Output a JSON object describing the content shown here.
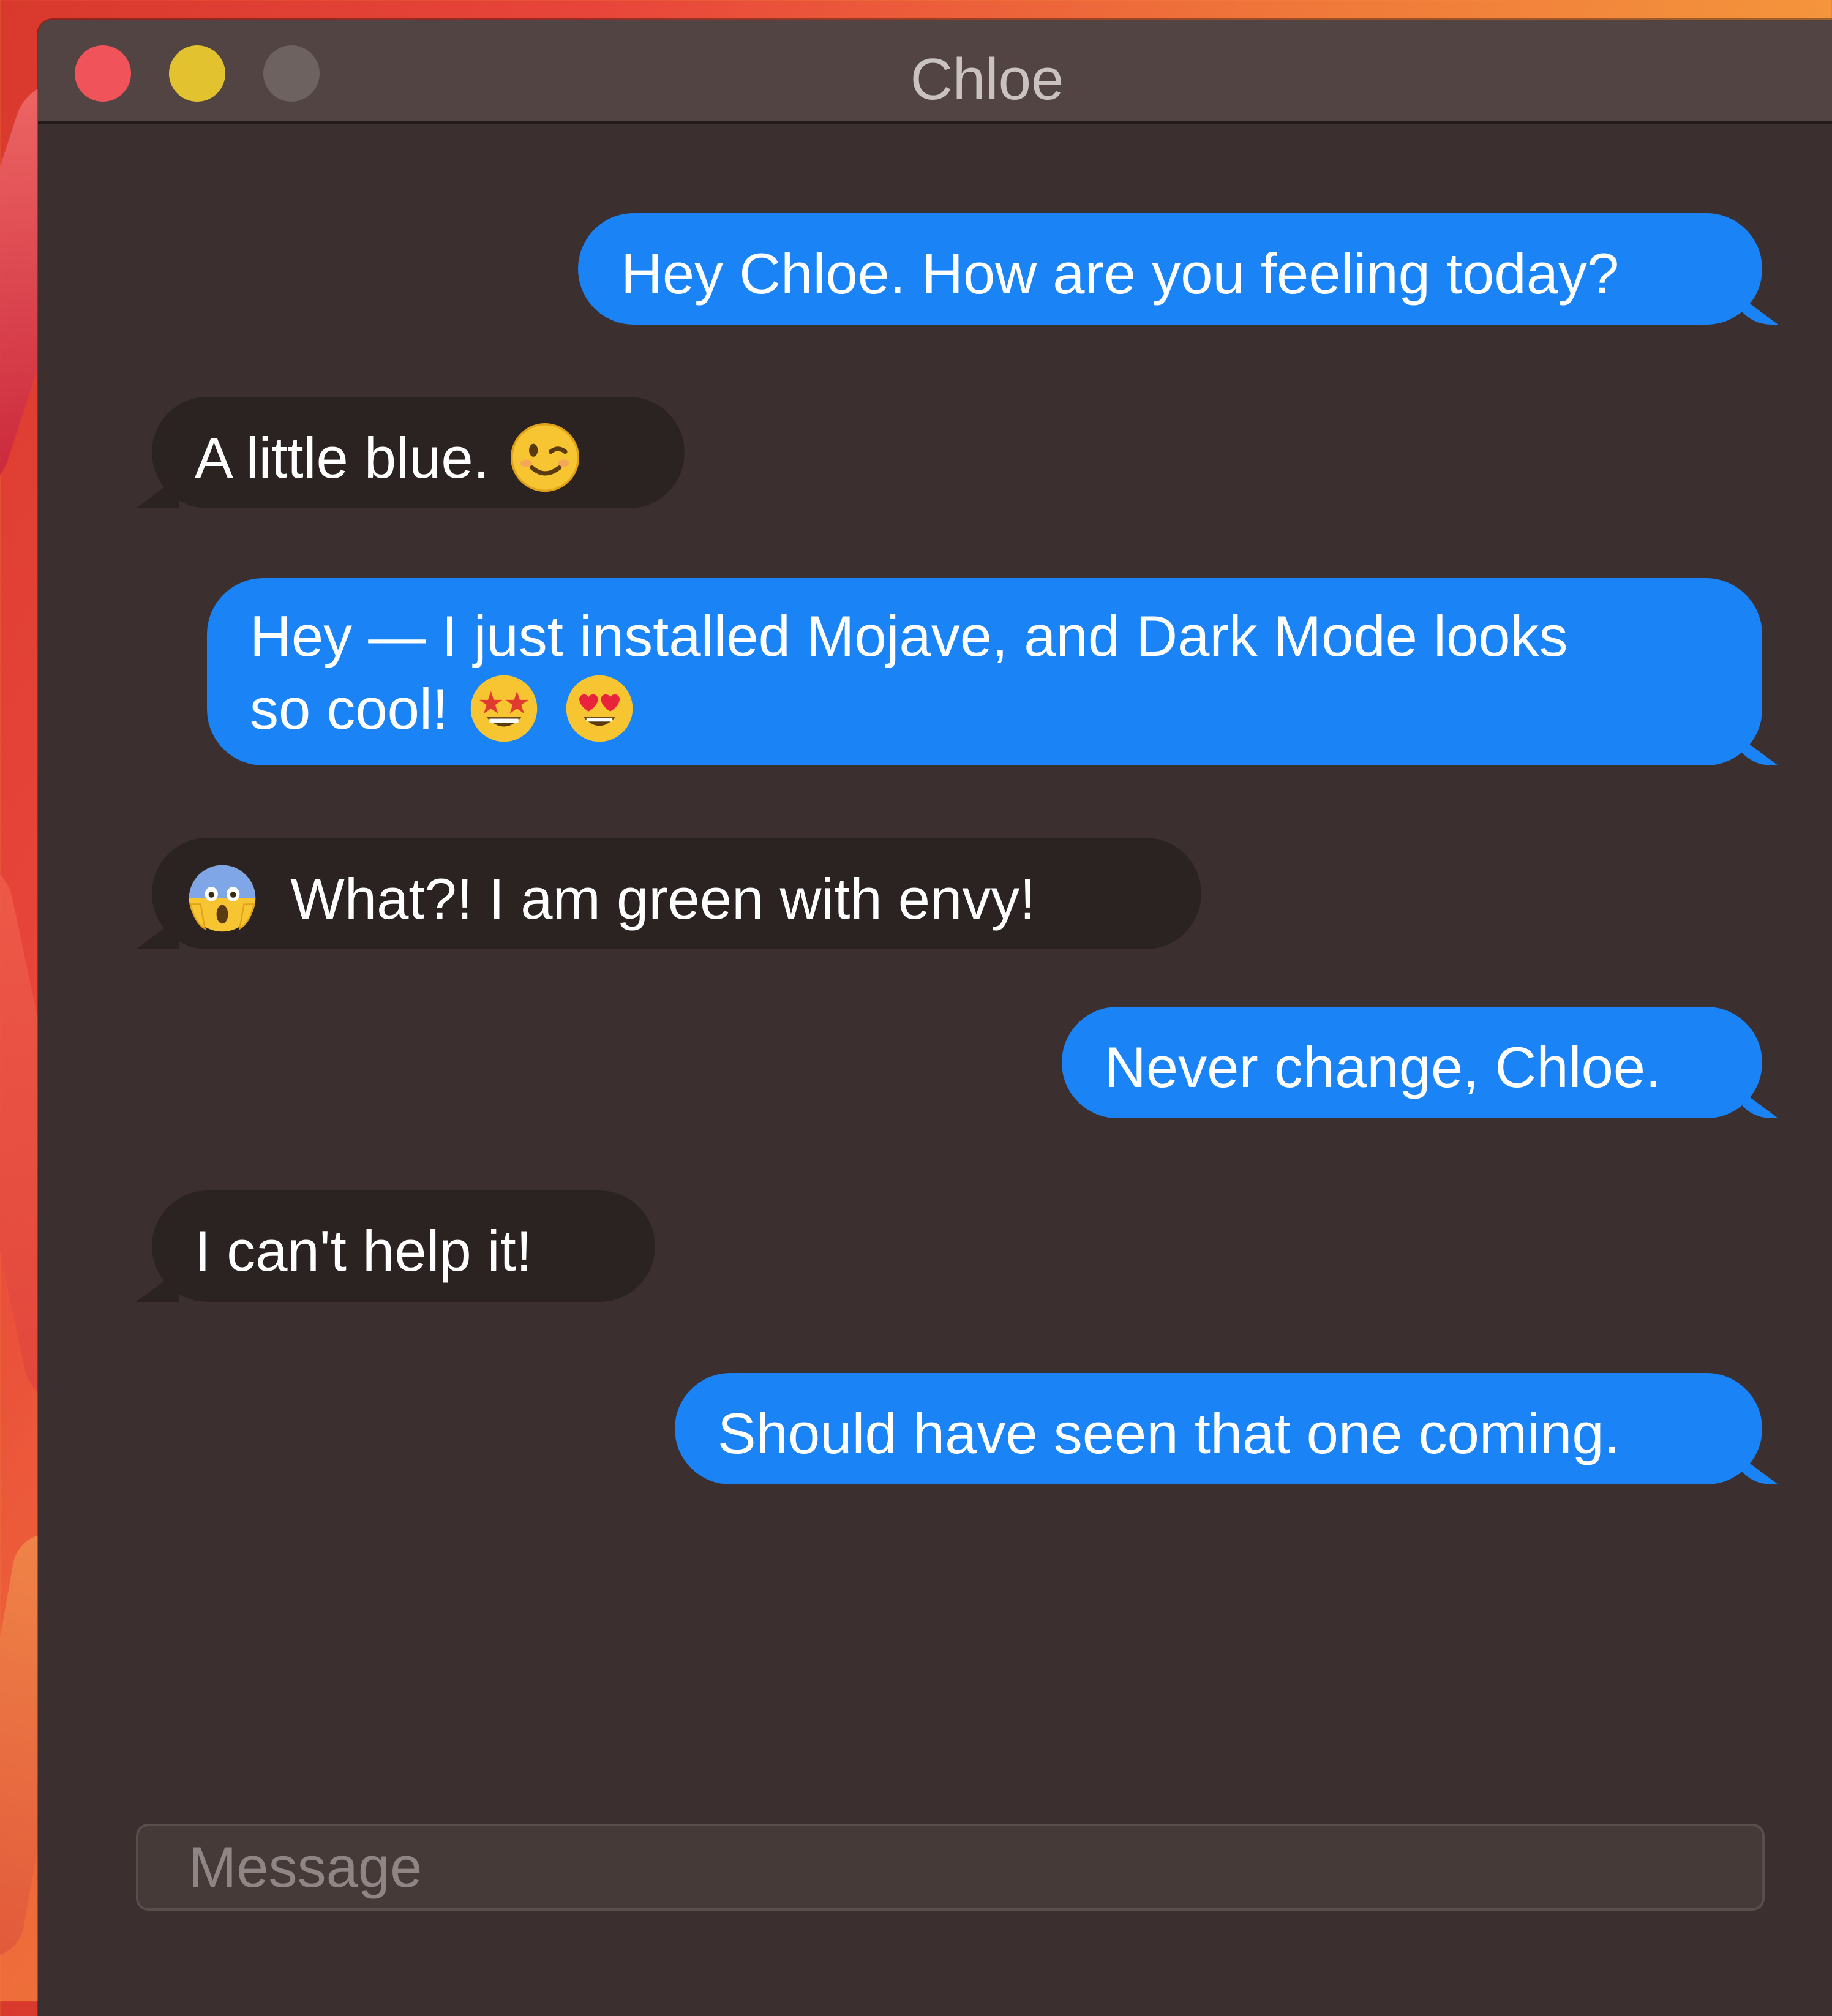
{
  "window": {
    "title": "Chloe"
  },
  "messages": [
    {
      "sender": "me",
      "text": "Hey Chloe. How are you feeling today?"
    },
    {
      "sender": "Chloe",
      "text": "A little blue.",
      "emoji_after": [
        "winking-face"
      ]
    },
    {
      "sender": "me",
      "text_line1": "Hey — I just installed Mojave, and Dark Mode looks",
      "text_line2": "so cool!",
      "emoji_after": [
        "star-struck",
        "heart-eyes"
      ]
    },
    {
      "sender": "Chloe",
      "emoji_before": [
        "face-screaming-in-fear"
      ],
      "text": "What?! I am green with envy!"
    },
    {
      "sender": "me",
      "text": "Never change, Chloe."
    },
    {
      "sender": "Chloe",
      "text": "I can't help it!"
    },
    {
      "sender": "me",
      "text": "Should have seen that one coming."
    }
  ],
  "composer": {
    "placeholder": "Message",
    "value": ""
  },
  "colors": {
    "sent_bubble": "#1a83f6",
    "received_bubble": "#2b2322",
    "window_background": "#3b302f",
    "titlebar": "#514442",
    "close": "#f0545a",
    "minimize": "#e2c22e",
    "zoom_disabled": "#6d6260"
  }
}
